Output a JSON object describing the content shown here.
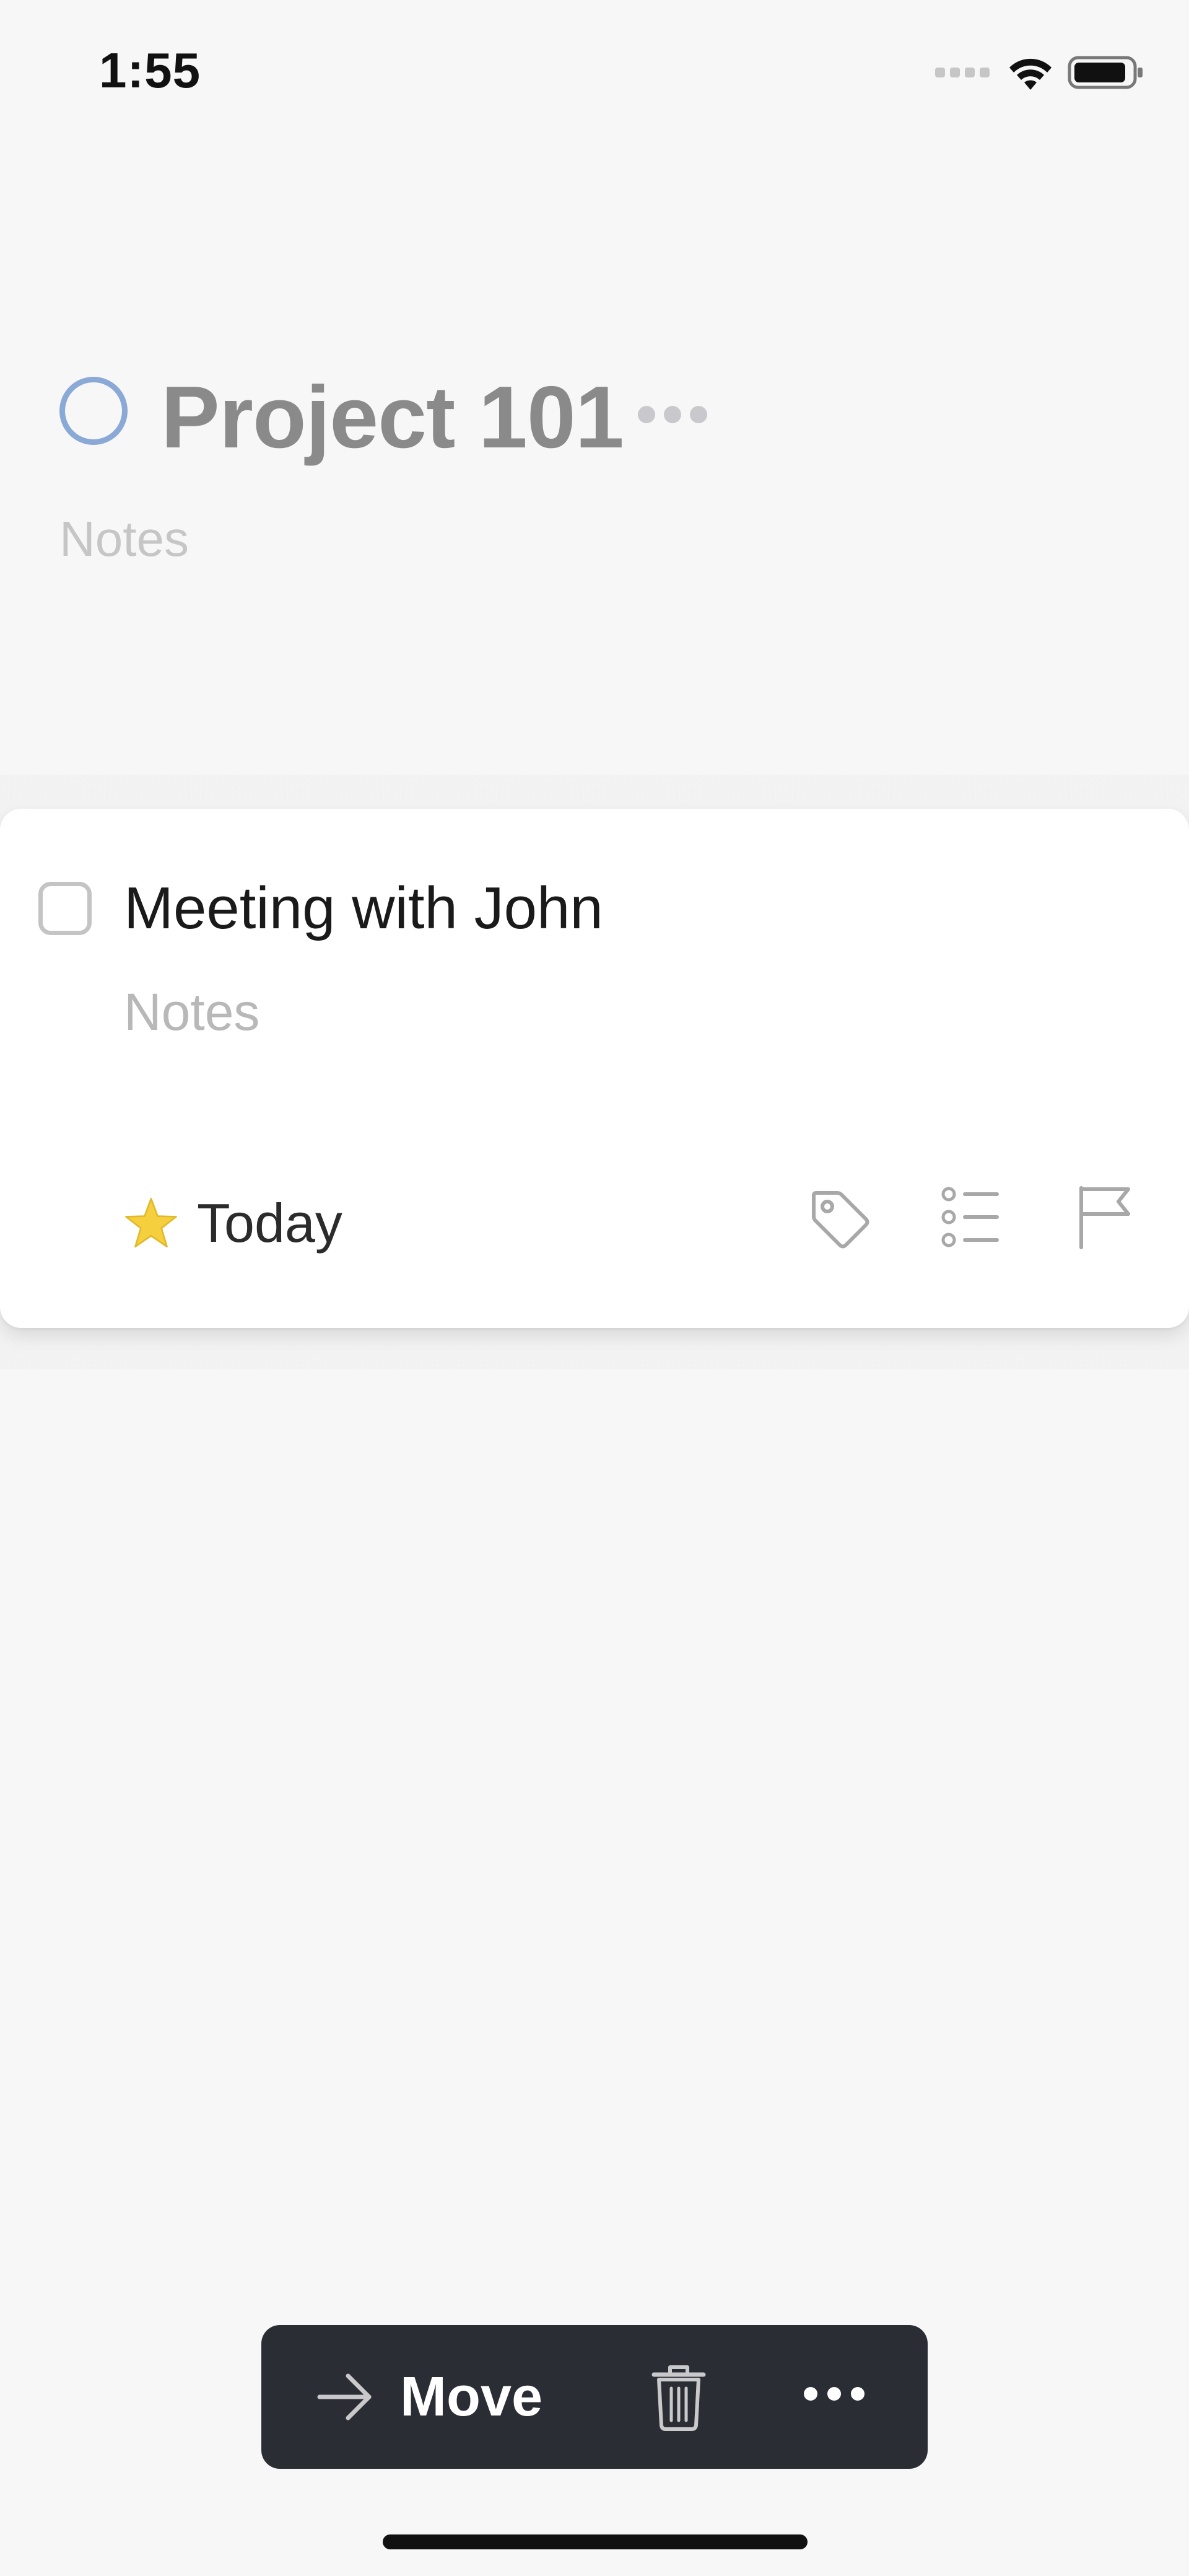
{
  "status_bar": {
    "time": "1:55",
    "icons": [
      "signal-icon",
      "wifi-icon",
      "battery-icon"
    ]
  },
  "project": {
    "title": "Project 101",
    "notes_placeholder": "Notes",
    "status_icon": "circle-icon",
    "more_icon": "ellipsis-icon",
    "ring_color": "#8aa9d6"
  },
  "task": {
    "title": "Meeting with John",
    "notes_placeholder": "Notes",
    "when_icon": "star-icon",
    "when_label": "Today",
    "star_color": "#f5cf3d",
    "actions": [
      "tag-icon",
      "checklist-icon",
      "flag-icon"
    ]
  },
  "toolbar": {
    "move_label": "Move",
    "move_icon": "arrow-right-icon",
    "delete_icon": "trash-icon",
    "more_icon": "ellipsis-icon",
    "background": "#2a2d33"
  }
}
